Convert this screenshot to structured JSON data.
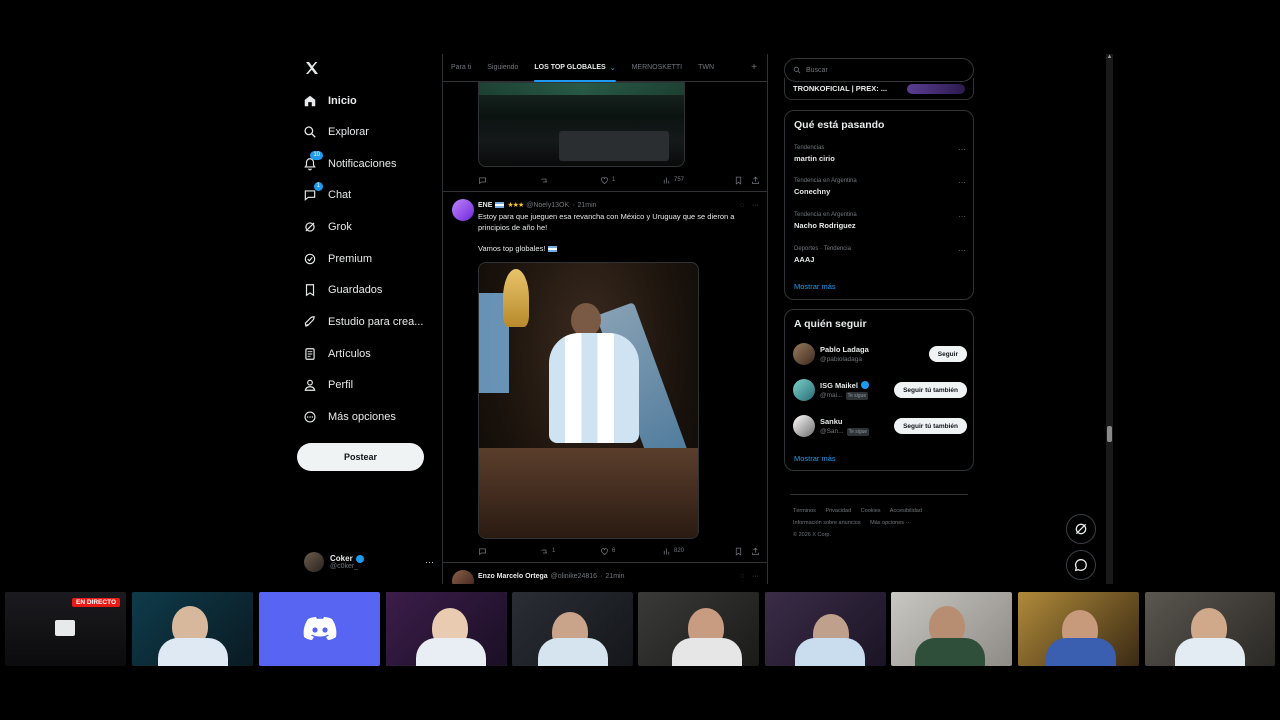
{
  "nav": {
    "items": [
      {
        "label": "Inicio",
        "icon": "home-icon",
        "active": true
      },
      {
        "label": "Explorar",
        "icon": "search-icon"
      },
      {
        "label": "Notificaciones",
        "icon": "bell-icon",
        "badge": "10"
      },
      {
        "label": "Chat",
        "icon": "chat-icon",
        "badge": "1"
      },
      {
        "label": "Grok",
        "icon": "grok-icon"
      },
      {
        "label": "Premium",
        "icon": "premium-icon"
      },
      {
        "label": "Guardados",
        "icon": "bookmark-icon"
      },
      {
        "label": "Estudio para crea...",
        "icon": "rocket-icon"
      },
      {
        "label": "Artículos",
        "icon": "articles-icon"
      },
      {
        "label": "Perfil",
        "icon": "person-icon"
      },
      {
        "label": "Más opciones",
        "icon": "more-circle-icon"
      }
    ],
    "post_label": "Postear",
    "account": {
      "name": "Coker",
      "handle": "@c0ker_"
    }
  },
  "tabs": [
    {
      "label": "Para ti"
    },
    {
      "label": "Siguiendo"
    },
    {
      "label": "LOS TOP GLOBALES",
      "active": true
    },
    {
      "label": "MERNOSKETTI"
    },
    {
      "label": "TWN"
    }
  ],
  "prev_tweet": {
    "likes": "1",
    "views": "757"
  },
  "tweet": {
    "name": "ENE",
    "handle": "@Noely13OK",
    "time": "21min",
    "text1": "Estoy para que jueguen esa revancha con México y Uruguay que se dieron a principios de año he!",
    "text2": "Vamos top globales!",
    "retweets": "1",
    "likes": "6",
    "views": "820"
  },
  "next_tweet": {
    "name": "Enzo Marcelo Ortega",
    "handle": "@olinike24816",
    "time": "21min"
  },
  "search": {
    "placeholder": "Buscar"
  },
  "live_card": {
    "label": "TRONKOFICIAL | PREX: ..."
  },
  "trending": {
    "title": "Qué está pasando",
    "items": [
      {
        "category": "Tendencias",
        "name": "martin cirio"
      },
      {
        "category": "Tendencia en Argentina",
        "name": "Conechny"
      },
      {
        "category": "Tendencia en Argentina",
        "name": "Nacho Rodriguez"
      },
      {
        "category": "Deportes · Tendencia",
        "name": "AAAJ"
      }
    ],
    "show_more": "Mostrar más"
  },
  "who_to_follow": {
    "title": "A quién seguir",
    "items": [
      {
        "name": "Pablo Ladaga",
        "handle": "@pabloladaga",
        "button": "Seguir"
      },
      {
        "name": "ISG Maikel",
        "handle": "@mai...",
        "follows_you": "Te sigue",
        "button": "Seguir tú también"
      },
      {
        "name": "Sanku",
        "handle": "@San...",
        "follows_you": "Te sigue",
        "button": "Seguir tú también"
      }
    ],
    "show_more": "Mostrar más"
  },
  "footer": {
    "links": [
      "Términos",
      "Privacidad",
      "Cookies",
      "Accesibilidad",
      "Información sobre anuncios",
      "Más opciones ···"
    ],
    "copyright": "© 2026 X Corp."
  },
  "stream_strip": {
    "live_label": "EN DIRECTO"
  },
  "colors": {
    "accent": "#1d9bf0",
    "background": "#000000",
    "live": "#e91916",
    "discord": "#5865f2"
  }
}
